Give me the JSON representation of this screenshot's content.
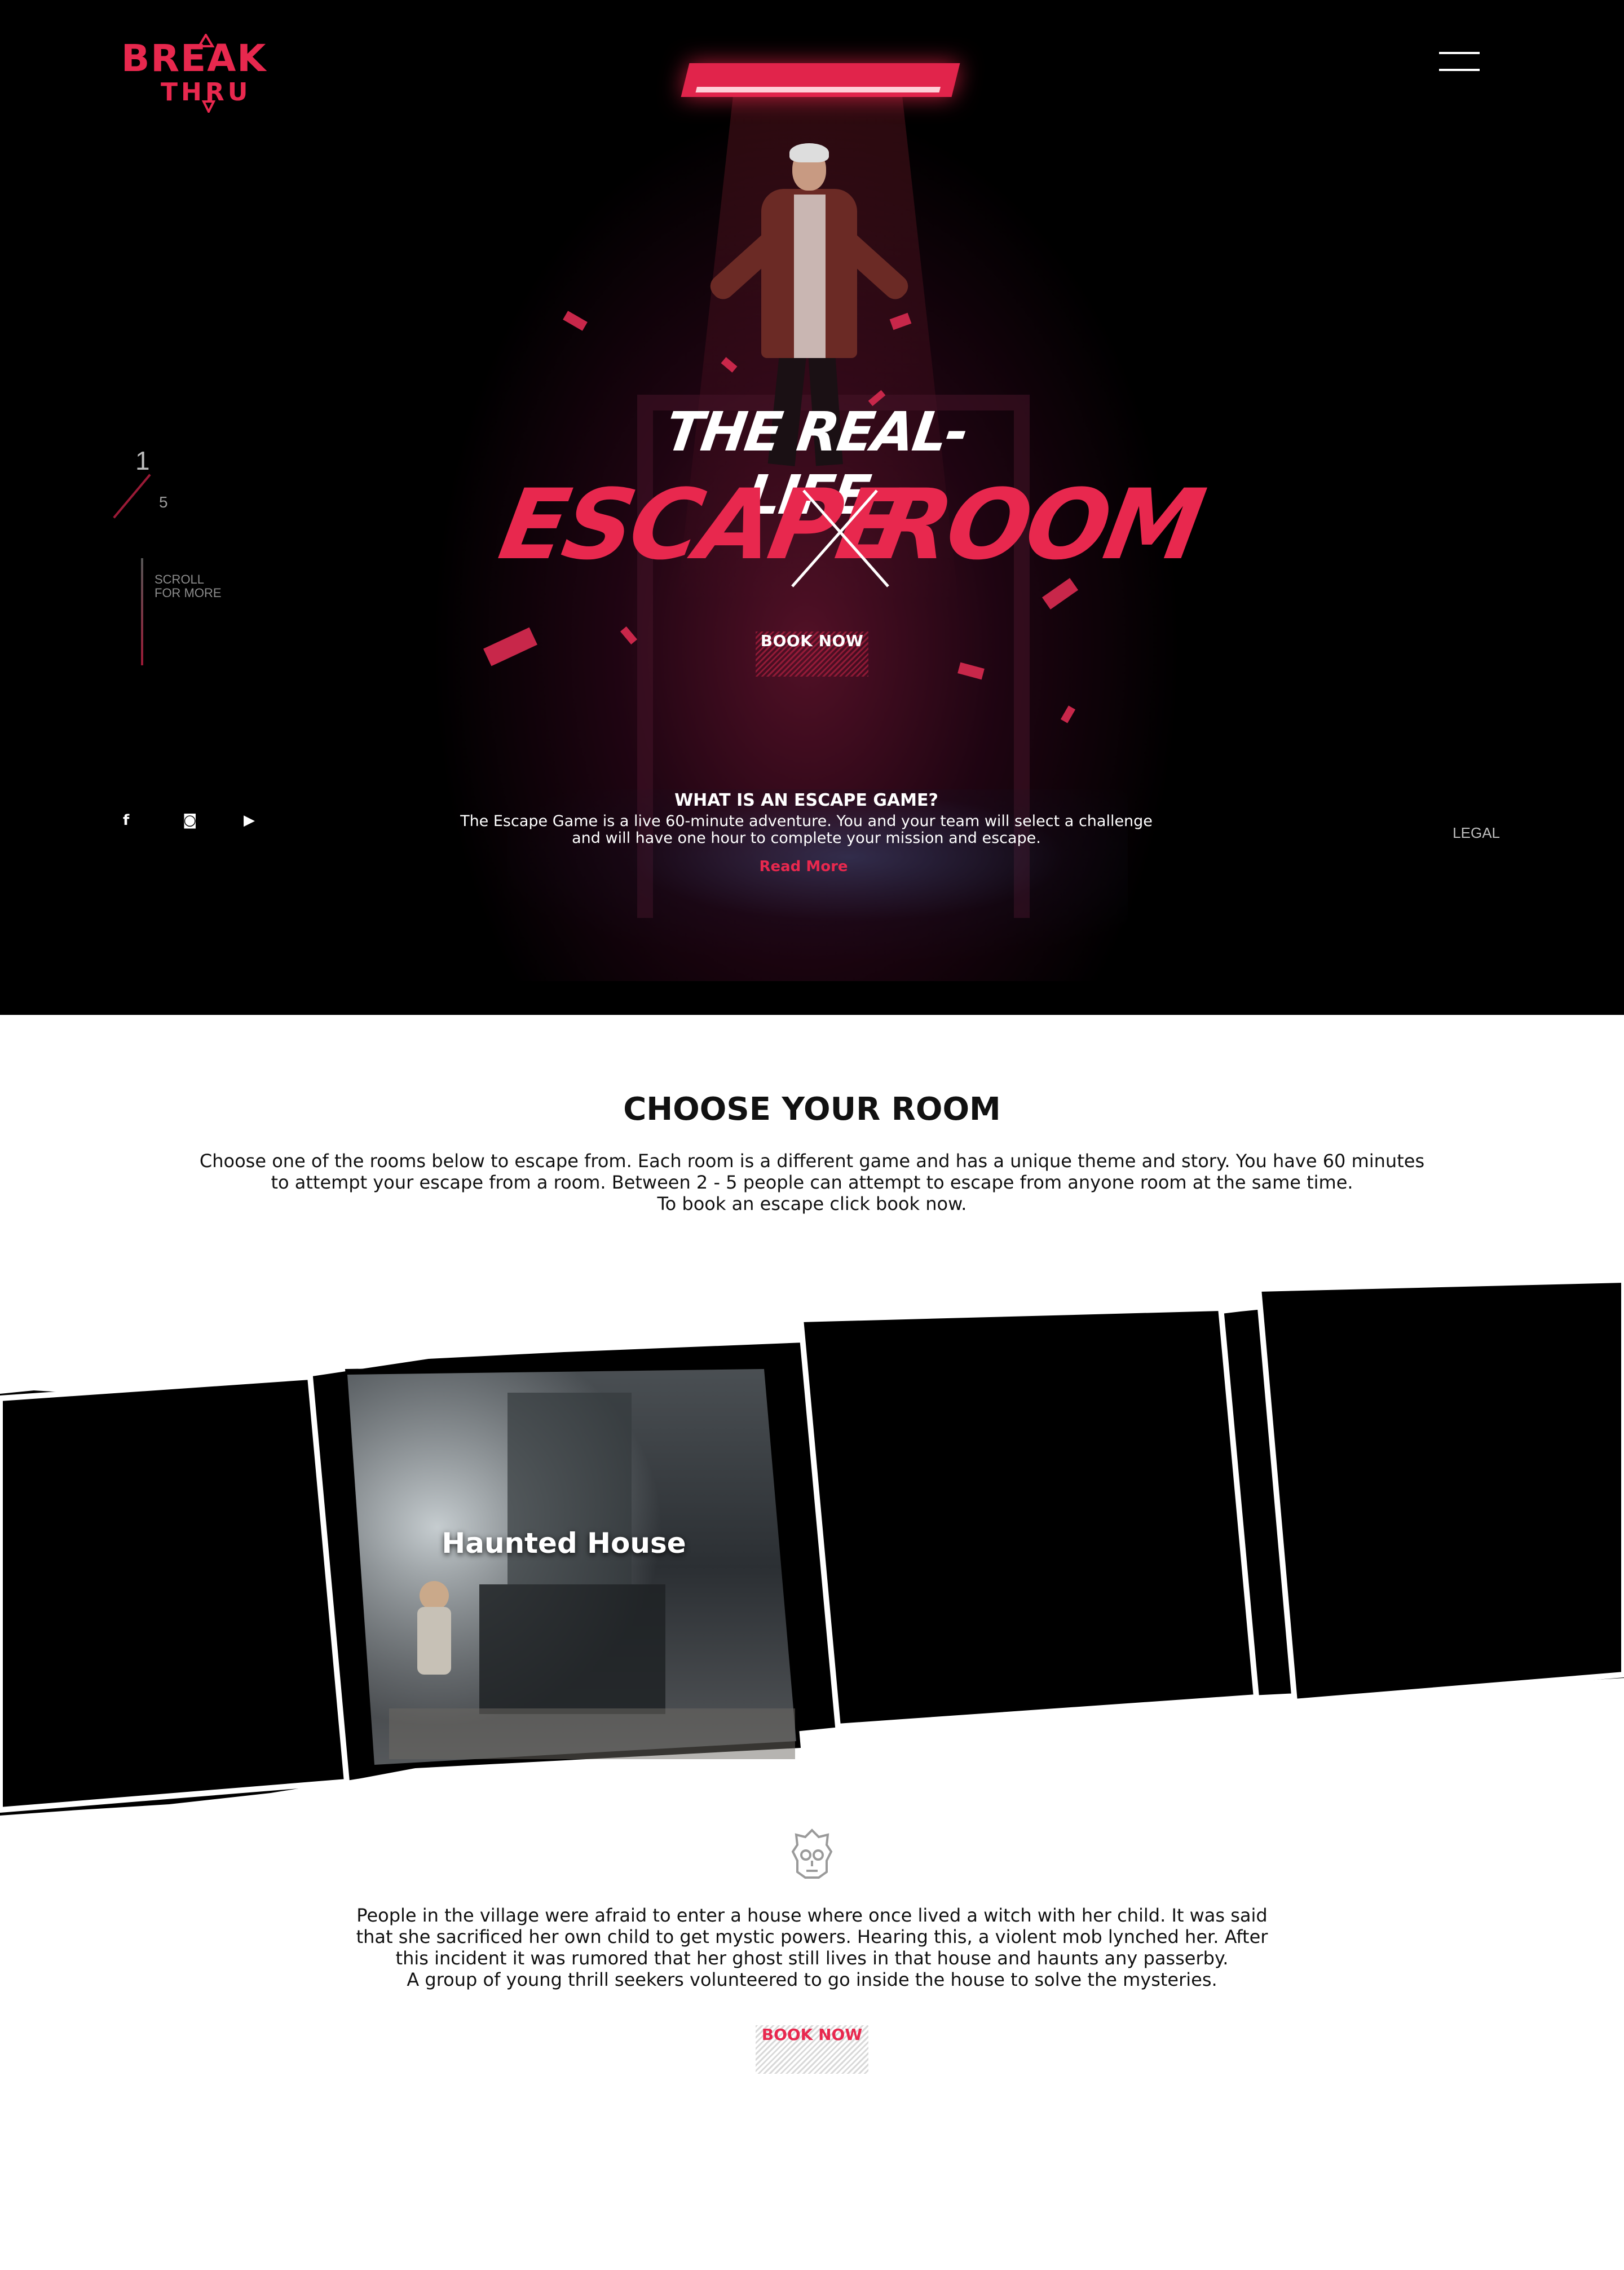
{
  "brand": {
    "line1": "BREAK",
    "line2": "THRU",
    "accent": "#e8284e"
  },
  "nav": {
    "menu_icon": "hamburger-menu-icon"
  },
  "slider": {
    "current": "1",
    "total": "5",
    "scroll_hint": "SCROLL FOR MORE"
  },
  "hero": {
    "title_top": "THE REAL-LIFE",
    "title_left": "ESCAPE",
    "title_right": "ROOM",
    "cta": "BOOK NOW",
    "what_title": "WHAT IS AN ESCAPE GAME?",
    "what_body": "The Escape Game is a live 60-minute adventure. You and your team will select a challenge\nand will have one hour to complete your mission and escape.",
    "read_more": "Read More",
    "social": [
      {
        "name": "facebook-icon",
        "glyph": "f"
      },
      {
        "name": "instagram-icon",
        "glyph": "◙"
      },
      {
        "name": "youtube-icon",
        "glyph": "▶"
      }
    ],
    "legal": "LEGAL"
  },
  "choose": {
    "title": "CHOOSE YOUR ROOM",
    "body": "Choose one of the rooms below to escape from. Each room is a different game and has a unique theme and story. You have 60 minutes\nto attempt your escape from a room. Between 2 - 5 people can attempt to escape from anyone room at the same time.\nTo book an escape click book now."
  },
  "rooms": [
    {
      "label": ""
    },
    {
      "label": "Haunted House"
    },
    {
      "label": ""
    },
    {
      "label": ""
    }
  ],
  "story": {
    "icon": "skull-icon",
    "text": "People in the village were afraid to enter a house where once lived a witch with her child. It was said\nthat she sacrificed her own child to get mystic powers. Hearing this, a violent mob lynched her. After\nthis incident it was rumored that her ghost still lives in that house and haunts any passerby.\nA group of young thrill seekers volunteered to go inside the house to solve the mysteries.",
    "cta": "BOOK NOW"
  }
}
